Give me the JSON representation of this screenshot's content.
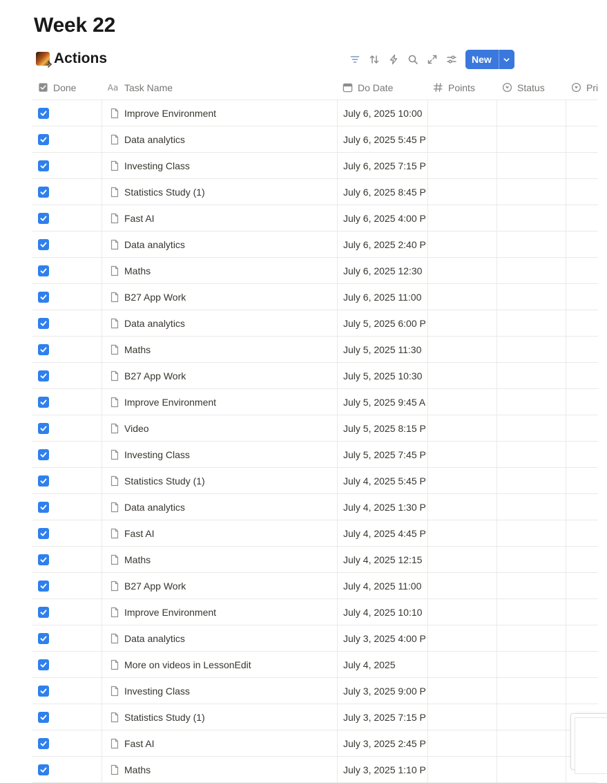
{
  "page": {
    "title": "Week 22"
  },
  "database": {
    "title": "Actions",
    "icon": "image-icon"
  },
  "toolbar": {
    "icons": [
      "filter-icon",
      "sort-icon",
      "automation-bolt-icon",
      "search-icon",
      "expand-icon",
      "settings-sliders-icon"
    ],
    "new_label": "New",
    "accent": "#3a78dd"
  },
  "columns": {
    "done": "Done",
    "name": "Task Name",
    "date": "Do Date",
    "points": "Points",
    "status": "Status",
    "priority": "Pri"
  },
  "rows": [
    {
      "done": true,
      "name": "Improve Environment",
      "date": "July 6, 2025 10:00"
    },
    {
      "done": true,
      "name": "Data analytics",
      "date": "July 6, 2025 5:45 P"
    },
    {
      "done": true,
      "name": "Investing Class",
      "date": "July 6, 2025 7:15 P"
    },
    {
      "done": true,
      "name": "Statistics Study (1)",
      "date": "July 6, 2025 8:45 P"
    },
    {
      "done": true,
      "name": "Fast AI",
      "date": "July 6, 2025 4:00 P"
    },
    {
      "done": true,
      "name": "Data analytics",
      "date": "July 6, 2025 2:40 P"
    },
    {
      "done": true,
      "name": "Maths",
      "date": "July 6, 2025 12:30"
    },
    {
      "done": true,
      "name": "B27 App Work",
      "date": "July 6, 2025 11:00"
    },
    {
      "done": true,
      "name": "Data analytics",
      "date": "July 5, 2025 6:00 P"
    },
    {
      "done": true,
      "name": "Maths",
      "date": "July 5, 2025 11:30"
    },
    {
      "done": true,
      "name": "B27 App Work",
      "date": "July 5, 2025 10:30"
    },
    {
      "done": true,
      "name": "Improve Environment",
      "date": "July 5, 2025 9:45 A"
    },
    {
      "done": true,
      "name": "Video",
      "date": "July 5, 2025 8:15 P"
    },
    {
      "done": true,
      "name": "Investing Class",
      "date": "July 5, 2025 7:45 P"
    },
    {
      "done": true,
      "name": "Statistics Study (1)",
      "date": "July 4, 2025 5:45 P"
    },
    {
      "done": true,
      "name": "Data analytics",
      "date": "July 4, 2025 1:30 P"
    },
    {
      "done": true,
      "name": "Fast AI",
      "date": "July 4, 2025 4:45 P"
    },
    {
      "done": true,
      "name": "Maths",
      "date": "July 4, 2025 12:15"
    },
    {
      "done": true,
      "name": "B27 App Work",
      "date": "July 4, 2025 11:00"
    },
    {
      "done": true,
      "name": "Improve Environment",
      "date": "July 4, 2025 10:10"
    },
    {
      "done": true,
      "name": "Data analytics",
      "date": "July 3, 2025 4:00 P"
    },
    {
      "done": true,
      "name": "More on videos in LessonEdit",
      "date": "July 4, 2025"
    },
    {
      "done": true,
      "name": "Investing Class",
      "date": "July 3, 2025 9:00 P"
    },
    {
      "done": true,
      "name": "Statistics Study (1)",
      "date": "July 3, 2025 7:15 P"
    },
    {
      "done": true,
      "name": "Fast AI",
      "date": "July 3, 2025 2:45 P"
    },
    {
      "done": true,
      "name": "Maths",
      "date": "July 3, 2025 1:10 P"
    }
  ]
}
